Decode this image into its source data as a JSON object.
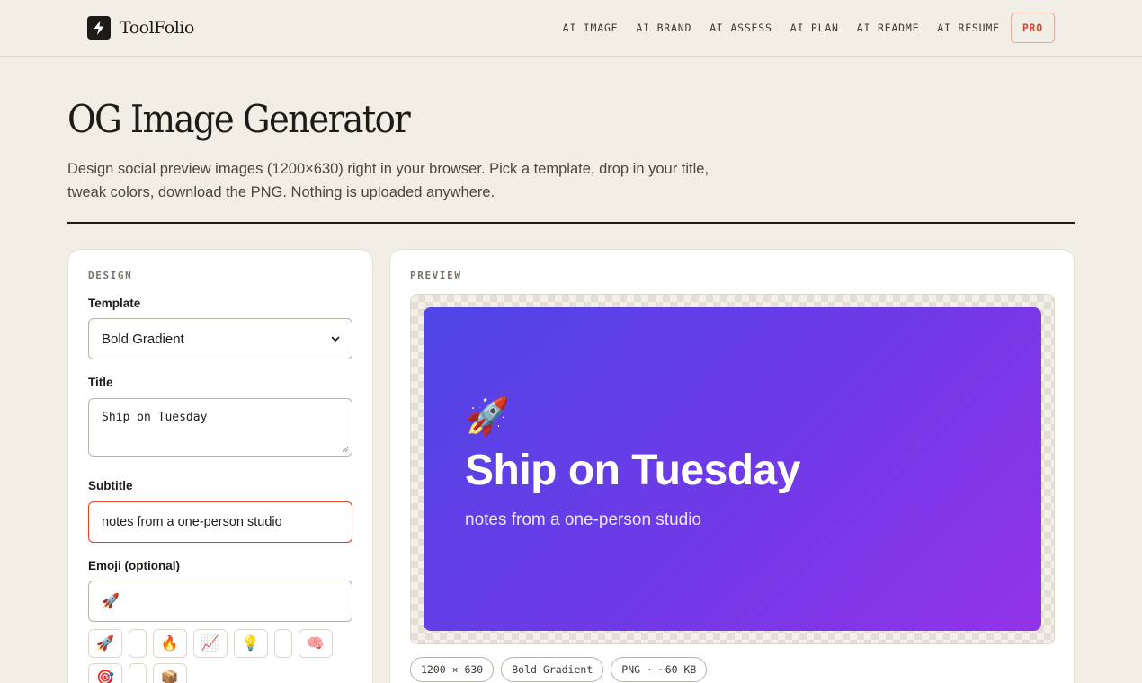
{
  "header": {
    "brand": "ToolFolio",
    "nav": [
      "AI IMAGE",
      "AI BRAND",
      "AI ASSESS",
      "AI PLAN",
      "AI README",
      "AI RESUME"
    ],
    "pro_label": "PRO"
  },
  "hero": {
    "title": "OG Image Generator",
    "description": "Design social preview images (1200×630) right in your browser. Pick a template, drop in your title, tweak colors, download the PNG. Nothing is uploaded anywhere."
  },
  "design": {
    "section_label": "DESIGN",
    "template_label": "Template",
    "template_value": "Bold Gradient",
    "title_label": "Title",
    "title_value": "Ship on Tuesday",
    "subtitle_label": "Subtitle",
    "subtitle_value": "notes from a one-person studio",
    "emoji_label": "Emoji (optional)",
    "emoji_value": "🚀",
    "emoji_options_row1": [
      "🚀",
      "",
      "🔥",
      "📈",
      "💡",
      "",
      "🧠"
    ],
    "emoji_options_row2": [
      "🎯",
      "",
      "📦"
    ]
  },
  "preview": {
    "section_label": "PREVIEW",
    "og_emoji": "🚀",
    "og_title": "Ship on Tuesday",
    "og_subtitle": "notes from a one-person studio",
    "gradient": [
      "#4f46e5",
      "#9333ea"
    ],
    "meta": [
      "1200 × 630",
      "Bold Gradient",
      "PNG · ~60 KB"
    ]
  },
  "colors": {
    "accent": "#d9482b",
    "background": "#f1eee6",
    "ink": "#1d1b17"
  }
}
